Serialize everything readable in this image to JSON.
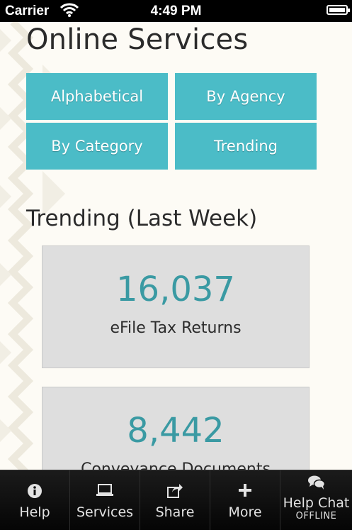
{
  "status_bar": {
    "carrier": "Carrier",
    "time": "4:49 PM"
  },
  "page": {
    "title": "Online Services"
  },
  "filters": [
    {
      "label": "Alphabetical"
    },
    {
      "label": "By Agency"
    },
    {
      "label": "By Category"
    },
    {
      "label": "Trending"
    }
  ],
  "trending": {
    "title": "Trending (Last Week)",
    "items": [
      {
        "count": "16,037",
        "label": "eFile Tax Returns"
      },
      {
        "count": "8,442",
        "label": "Conveyance Documents"
      }
    ]
  },
  "tab_bar": {
    "items": [
      {
        "label": "Help",
        "icon": "info-icon"
      },
      {
        "label": "Services",
        "icon": "laptop-icon"
      },
      {
        "label": "Share",
        "icon": "share-icon"
      },
      {
        "label": "More",
        "icon": "plus-icon"
      },
      {
        "label": "Help Chat",
        "sublabel": "OFFLINE",
        "icon": "chat-bubbles-icon"
      }
    ]
  },
  "colors": {
    "accent": "#4bbcc7",
    "count_text": "#3a9aa3",
    "card_bg": "#dedede"
  }
}
